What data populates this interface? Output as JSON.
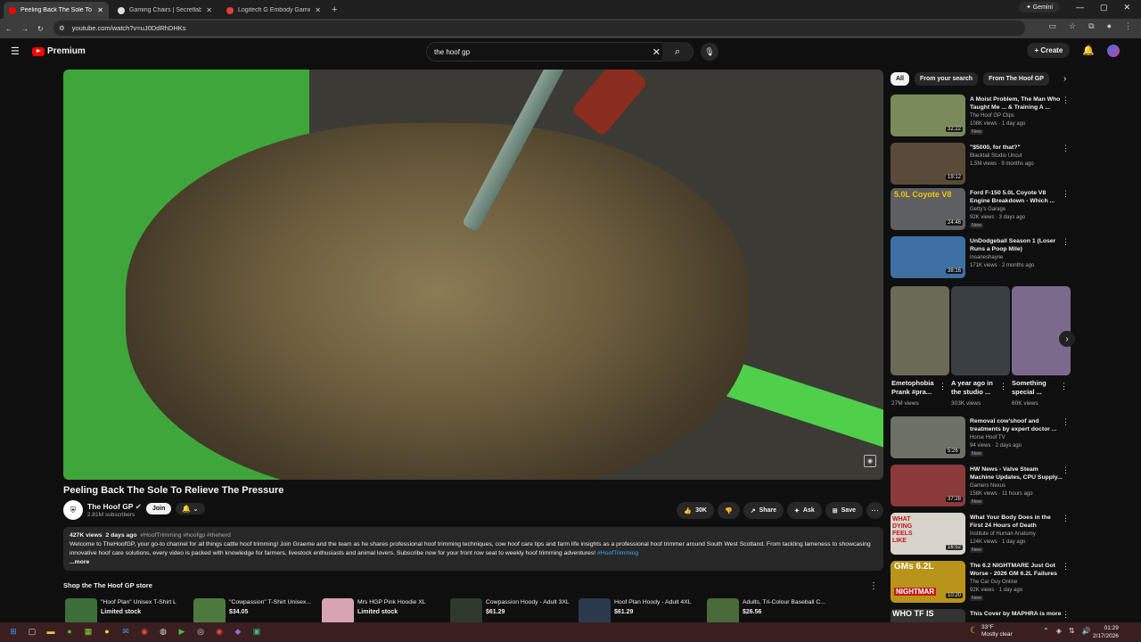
{
  "browser": {
    "tabs": [
      {
        "title": "Peeling Back The Sole To Relie",
        "active": true,
        "color": "#ff0000"
      },
      {
        "title": "Gaming Chairs | Secretlab TITA",
        "active": false,
        "color": "#dddddd"
      },
      {
        "title": "Logitech G Embody Gaming Ch",
        "active": false,
        "color": "#e83b3b"
      }
    ],
    "gemini_label": "Gemini",
    "url": "youtube.com/watch?v=uJ0DdRhDHKs"
  },
  "header": {
    "logo_label": "Premium",
    "search_value": "the hoof gp",
    "create_label": "Create"
  },
  "video": {
    "title": "Peeling Back The Sole To Relieve The Pressure",
    "channel": "The Hoof GP",
    "subscribers": "2.81M subscribers",
    "join_label": "Join",
    "likes": "30K",
    "share_label": "Share",
    "ask_label": "Ask",
    "save_label": "Save",
    "description": {
      "views": "427K views",
      "age": "2 days ago",
      "hashtags": "#HoofTrimming #hoofgp #theherd",
      "text": "Welcome to TheHoofGP, your go-to channel for all things cattle hoof trimming! Join Graeme and the team as he shares professional hoof trimming techniques, cow hoof care tips and farm life insights as a professional hoof trimmer around South West Scotland. From tackling lameness to showcasing innovative hoof care solutions, every video is packed with knowledge for farmers, livestock enthusiasts and animal lovers. Subscribe now for your front row seat to weekly hoof trimming adventures!",
      "tag": "#HoofTrimming",
      "more_label": "...more"
    }
  },
  "store": {
    "heading": "Shop the The Hoof GP store",
    "products": [
      {
        "name": "\"Hoof Plan\" Unisex T-Shirt L",
        "price": "Limited stock"
      },
      {
        "name": "\"Cowpassion\" T-Shirt Unisex...",
        "price": "$34.05"
      },
      {
        "name": "Mrs HGP Pink Hoodie XL",
        "price": "Limited stock"
      },
      {
        "name": "Cowpassion Hoody - Adult 3XL",
        "price": "$61.29"
      },
      {
        "name": "Hoof Plan Hoody - Adult 4XL",
        "price": "$61.29"
      },
      {
        "name": "Adults, Tri-Colour Baseball C...",
        "price": "$26.56"
      }
    ]
  },
  "chips": [
    "All",
    "From your search",
    "From The Hoof GP"
  ],
  "recommendations_top": [
    {
      "title": "A Moist Problem, The Man Who Taught Me ... & Training A ...",
      "channel": "The Hoof GP Clips",
      "views": "108K views · 1 day ago",
      "badge": "New",
      "duration": "32:22",
      "thumb": "#7a8a5a"
    },
    {
      "title": "\"$5000, for that?\"",
      "channel": "Blacktail Studio Uncut",
      "views": "1.5M views · 9 months ago",
      "badge": "",
      "duration": "19:12",
      "thumb": "#5a4a3a"
    },
    {
      "title": "Ford F-150 5.0L Coyote V8 Engine Breakdown - Which ...",
      "channel": "Getty's Garage",
      "views": "92K views · 3 days ago",
      "badge": "New",
      "duration": "24:46",
      "thumb": "#5d5f62"
    },
    {
      "title": "UnDodgeball Season 1 (Loser Runs a Poop Mile)",
      "channel": "Insaneshayne",
      "views": "171K views · 2 months ago",
      "badge": "",
      "duration": "38:16",
      "thumb": "#3d6fa3"
    }
  ],
  "shorts": [
    {
      "title": "Emetophobia Prank #pra...",
      "views": "27M views",
      "thumb": "#6a6a56"
    },
    {
      "title": "A year ago in the studio ...",
      "views": "303K views",
      "thumb": "#3a3f44"
    },
    {
      "title": "Something special ...",
      "views": "60K views",
      "thumb": "#7c6a8c"
    }
  ],
  "recommendations_bottom": [
    {
      "title": "Removal cow'shoof and treatments by expert doctor ...",
      "channel": "Horse Hoof TV",
      "views": "94 views · 2 days ago",
      "badge": "New",
      "duration": "5:26",
      "thumb": "#6c7066"
    },
    {
      "title": "HW News - Valve Steam Machine Updates, CPU Supply...",
      "channel": "Gamers Nexus",
      "views": "158K views · 11 hours ago",
      "badge": "New",
      "duration": "37:28",
      "thumb": "#8a3a3a"
    },
    {
      "title": "What Your Body Does in the First 24 Hours of Death",
      "channel": "Institute of Human Anatomy",
      "views": "124K views · 1 day ago",
      "badge": "New",
      "duration": "16:52",
      "thumb": "#d8d4cc"
    },
    {
      "title": "The 6.2 NIGHTMARE Just Got Worse - 2026 GM 6.2L Failures",
      "channel": "The Car Guy Online",
      "views": "92K views · 1 day ago",
      "badge": "New",
      "duration": "10:20",
      "thumb": "#b8941a"
    },
    {
      "title": "This Cover by MAPHRA is more",
      "channel": "",
      "views": "",
      "badge": "",
      "duration": "",
      "thumb": "#333333"
    }
  ],
  "thumb_texts": [
    "5.0L Coyote V8",
    "GMs 6.2L",
    "NIGHTMAR",
    "WHAT DYING FEELS LIKE",
    "WHO TF IS"
  ],
  "taskbar": {
    "weather_temp": "33°F",
    "weather_desc": "Mostly clear",
    "time": "01:29",
    "date": "2/17/2026"
  }
}
